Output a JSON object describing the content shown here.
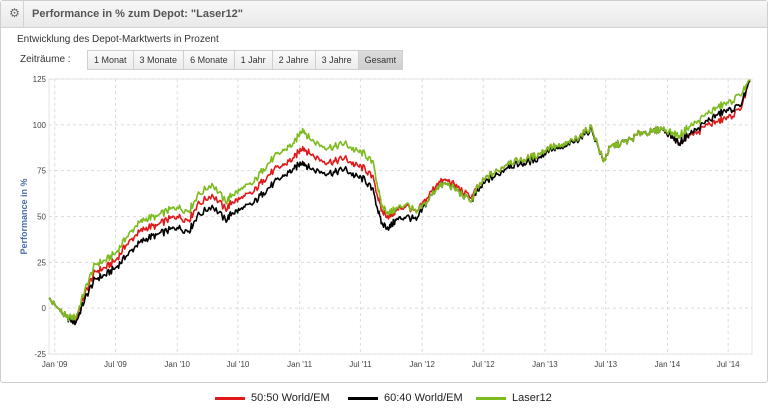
{
  "panel": {
    "title": "Performance in % zum Depot: \"Laser12\"",
    "icon": "gear-icon"
  },
  "subtitle": "Entwicklung des Depot-Marktwerts in Prozent",
  "ranges": {
    "label": "Zeiträume :",
    "buttons": [
      "1 Monat",
      "3 Monate",
      "6 Monate",
      "1 Jahr",
      "2 Jahre",
      "3 Jahre",
      "Gesamt"
    ],
    "active": "Gesamt"
  },
  "chart_data": {
    "type": "line",
    "ylabel": "Performance in %",
    "ylim": [
      -25,
      125
    ],
    "yticks": [
      -25,
      0,
      25,
      50,
      75,
      100,
      125
    ],
    "xlim": [
      "2008-12-15",
      "2014-09-10"
    ],
    "xticks": [
      {
        "date": "2009-01-01",
        "label": "Jan '09"
      },
      {
        "date": "2009-07-01",
        "label": "Jul '09"
      },
      {
        "date": "2010-01-01",
        "label": "Jan '10"
      },
      {
        "date": "2010-07-01",
        "label": "Jul '10"
      },
      {
        "date": "2011-01-01",
        "label": "Jan '11"
      },
      {
        "date": "2011-07-01",
        "label": "Jul '11"
      },
      {
        "date": "2012-01-01",
        "label": "Jan '12"
      },
      {
        "date": "2012-07-01",
        "label": "Jul '12"
      },
      {
        "date": "2013-01-01",
        "label": "Jan '13"
      },
      {
        "date": "2013-07-01",
        "label": "Jul '13"
      },
      {
        "date": "2014-01-01",
        "label": "Jan '14"
      },
      {
        "date": "2014-07-01",
        "label": "Jul '14"
      }
    ],
    "grid": true,
    "legend": "bottom",
    "series": [
      {
        "name": "50:50 World/EM",
        "color": "#e01a1a",
        "x": [
          "2008-12-15",
          "2009-01-10",
          "2009-02-05",
          "2009-03-05",
          "2009-04-01",
          "2009-05-01",
          "2009-06-01",
          "2009-07-01",
          "2009-08-01",
          "2009-09-01",
          "2009-10-01",
          "2009-11-01",
          "2009-12-01",
          "2010-01-01",
          "2010-02-05",
          "2010-03-01",
          "2010-04-15",
          "2010-05-25",
          "2010-06-15",
          "2010-07-15",
          "2010-08-15",
          "2010-09-15",
          "2010-10-15",
          "2010-11-15",
          "2010-12-15",
          "2011-01-10",
          "2011-02-01",
          "2011-03-15",
          "2011-04-15",
          "2011-05-15",
          "2011-06-15",
          "2011-07-15",
          "2011-08-10",
          "2011-09-01",
          "2011-09-25",
          "2011-10-15",
          "2011-11-15",
          "2011-12-15",
          "2012-01-15",
          "2012-02-15",
          "2012-03-15",
          "2012-04-15",
          "2012-05-25",
          "2012-06-15",
          "2012-07-15",
          "2012-08-15",
          "2012-09-15",
          "2012-10-15",
          "2012-11-15",
          "2012-12-15",
          "2013-01-15",
          "2013-02-15",
          "2013-03-15",
          "2013-04-15",
          "2013-05-20",
          "2013-06-24",
          "2013-07-15",
          "2013-08-15",
          "2013-09-15",
          "2013-10-15",
          "2013-11-15",
          "2013-12-15",
          "2014-01-15",
          "2014-02-05",
          "2014-03-01",
          "2014-04-01",
          "2014-05-01",
          "2014-06-01",
          "2014-07-01",
          "2014-08-05",
          "2014-09-05"
        ],
        "y": [
          5,
          0,
          -5,
          -6,
          8,
          20,
          22,
          26,
          34,
          40,
          44,
          45,
          48,
          50,
          48,
          56,
          62,
          54,
          58,
          60,
          63,
          70,
          75,
          78,
          82,
          88,
          84,
          80,
          80,
          82,
          78,
          76,
          70,
          53,
          50,
          53,
          56,
          52,
          60,
          68,
          70,
          66,
          60,
          66,
          72,
          75,
          80,
          80,
          82,
          84,
          88,
          88,
          90,
          94,
          99,
          80,
          88,
          90,
          92,
          96,
          96,
          98,
          94,
          90,
          94,
          96,
          100,
          102,
          104,
          108,
          124
        ]
      },
      {
        "name": "60:40 World/EM",
        "color": "#000000",
        "x": [
          "2008-12-15",
          "2009-01-10",
          "2009-02-05",
          "2009-03-05",
          "2009-04-01",
          "2009-05-01",
          "2009-06-01",
          "2009-07-01",
          "2009-08-01",
          "2009-09-01",
          "2009-10-01",
          "2009-11-01",
          "2009-12-01",
          "2010-01-01",
          "2010-02-05",
          "2010-03-01",
          "2010-04-15",
          "2010-05-25",
          "2010-06-15",
          "2010-07-15",
          "2010-08-15",
          "2010-09-15",
          "2010-10-15",
          "2010-11-15",
          "2010-12-15",
          "2011-01-10",
          "2011-02-01",
          "2011-03-15",
          "2011-04-15",
          "2011-05-15",
          "2011-06-15",
          "2011-07-15",
          "2011-08-10",
          "2011-09-01",
          "2011-09-25",
          "2011-10-15",
          "2011-11-15",
          "2011-12-15",
          "2012-01-15",
          "2012-02-15",
          "2012-03-15",
          "2012-04-15",
          "2012-05-25",
          "2012-06-15",
          "2012-07-15",
          "2012-08-15",
          "2012-09-15",
          "2012-10-15",
          "2012-11-15",
          "2012-12-15",
          "2013-01-15",
          "2013-02-15",
          "2013-03-15",
          "2013-04-15",
          "2013-05-20",
          "2013-06-24",
          "2013-07-15",
          "2013-08-15",
          "2013-09-15",
          "2013-10-15",
          "2013-11-15",
          "2013-12-15",
          "2014-01-15",
          "2014-02-05",
          "2014-03-01",
          "2014-04-01",
          "2014-05-01",
          "2014-06-01",
          "2014-07-01",
          "2014-08-05",
          "2014-09-05"
        ],
        "y": [
          5,
          0,
          -5,
          -8,
          5,
          16,
          18,
          22,
          28,
          34,
          38,
          40,
          42,
          44,
          42,
          50,
          56,
          48,
          52,
          54,
          57,
          63,
          68,
          72,
          76,
          80,
          76,
          74,
          74,
          76,
          72,
          70,
          63,
          46,
          44,
          48,
          50,
          48,
          58,
          66,
          68,
          64,
          58,
          64,
          70,
          73,
          78,
          78,
          80,
          82,
          87,
          87,
          89,
          93,
          98,
          80,
          88,
          90,
          92,
          96,
          96,
          98,
          94,
          90,
          94,
          98,
          102,
          106,
          108,
          110,
          124
        ]
      },
      {
        "name": "Laser12",
        "color": "#7dbb1f",
        "x": [
          "2008-12-15",
          "2009-01-10",
          "2009-02-05",
          "2009-03-05",
          "2009-04-01",
          "2009-05-01",
          "2009-06-01",
          "2009-07-01",
          "2009-08-01",
          "2009-09-01",
          "2009-10-01",
          "2009-11-01",
          "2009-12-01",
          "2010-01-01",
          "2010-02-05",
          "2010-03-01",
          "2010-04-15",
          "2010-05-25",
          "2010-06-15",
          "2010-07-15",
          "2010-08-15",
          "2010-09-15",
          "2010-10-15",
          "2010-11-15",
          "2010-12-15",
          "2011-01-10",
          "2011-02-01",
          "2011-03-15",
          "2011-04-15",
          "2011-05-15",
          "2011-06-15",
          "2011-07-15",
          "2011-08-10",
          "2011-09-01",
          "2011-09-25",
          "2011-10-15",
          "2011-11-15",
          "2011-12-15",
          "2012-01-15",
          "2012-02-15",
          "2012-03-15",
          "2012-04-15",
          "2012-05-25",
          "2012-06-15",
          "2012-07-15",
          "2012-08-15",
          "2012-09-15",
          "2012-10-15",
          "2012-11-15",
          "2012-12-15",
          "2013-01-15",
          "2013-02-15",
          "2013-03-15",
          "2013-04-15",
          "2013-05-20",
          "2013-06-24",
          "2013-07-15",
          "2013-08-15",
          "2013-09-15",
          "2013-10-15",
          "2013-11-15",
          "2013-12-15",
          "2014-01-15",
          "2014-02-05",
          "2014-03-01",
          "2014-04-01",
          "2014-05-01",
          "2014-06-01",
          "2014-07-01",
          "2014-08-05",
          "2014-09-05"
        ],
        "y": [
          5,
          0,
          -5,
          -5,
          10,
          24,
          26,
          30,
          38,
          45,
          49,
          50,
          53,
          55,
          53,
          61,
          68,
          58,
          62,
          65,
          68,
          76,
          82,
          86,
          90,
          98,
          92,
          88,
          88,
          90,
          86,
          84,
          78,
          56,
          52,
          54,
          57,
          52,
          58,
          66,
          68,
          64,
          58,
          66,
          72,
          75,
          80,
          80,
          82,
          84,
          88,
          88,
          90,
          94,
          99,
          80,
          88,
          90,
          92,
          96,
          96,
          98,
          96,
          94,
          98,
          102,
          106,
          110,
          112,
          116,
          124
        ]
      }
    ]
  }
}
